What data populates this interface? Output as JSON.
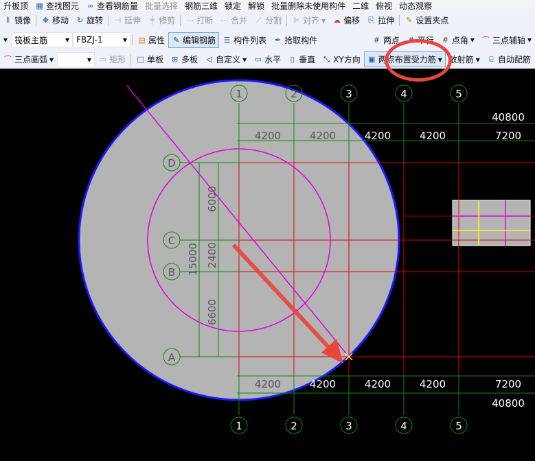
{
  "toolbar1": [
    "升板顶",
    "查找图元",
    "查看钢筋量",
    "批量选择",
    "钢筋三维",
    "锁定",
    "解锁",
    "批量删除未使用构件",
    "二维",
    "俯视",
    "动态观察"
  ],
  "toolbar2": {
    "items": [
      "镜像",
      "移动",
      "旋转",
      "延伸",
      "修剪",
      "打断",
      "合并",
      "分割",
      "对齐",
      "偏移",
      "拉伸",
      "设置夹点"
    ]
  },
  "toolbar3": {
    "type_select": "筏板主筋",
    "name_select": "FBZJ-1",
    "items": [
      "属性",
      "编辑钢筋",
      "构件列表",
      "拾取构件",
      "两点",
      "平行",
      "点角",
      "三点辅轴"
    ]
  },
  "toolbar4": {
    "arc_select": "三点画弧",
    "items": [
      "矩形",
      "单板",
      "多板",
      "自定义",
      "水平",
      "垂直",
      "XY方向",
      "两点布置受力筋",
      "放射筋",
      "自动配筋"
    ]
  },
  "drawing": {
    "col_labels": [
      "1",
      "2",
      "3",
      "4",
      "5"
    ],
    "row_labels": [
      "D",
      "C",
      "B",
      "A"
    ],
    "top_total": "40800",
    "bottom_total": "40800",
    "spans": [
      "4200",
      "4200",
      "4200",
      "4200",
      "7200"
    ],
    "v_total": "15000",
    "v_spans": [
      "6000",
      "2400",
      "6600"
    ]
  },
  "annotation_color": "#e8453c"
}
